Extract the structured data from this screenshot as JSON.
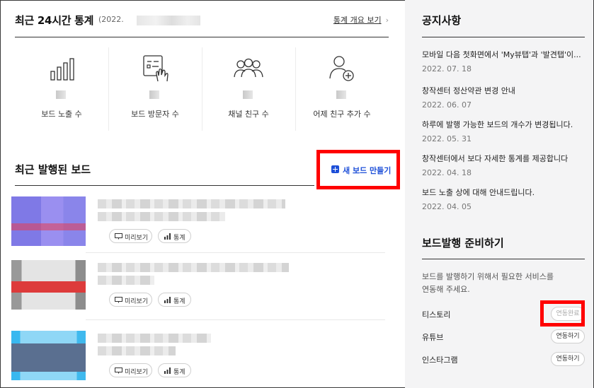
{
  "stats": {
    "title": "최근 24시간 통계",
    "date_prefix": "(2022.",
    "overview_link": "통계 개요 보기",
    "items": [
      {
        "label": "보드 노출 수",
        "icon": "bar-chart-icon"
      },
      {
        "label": "보드 방문자 수",
        "icon": "board-touch-icon"
      },
      {
        "label": "채널 친구 수",
        "icon": "group-friends-icon"
      },
      {
        "label": "어제 친구 추가 수",
        "icon": "add-friend-icon"
      }
    ]
  },
  "boards": {
    "title": "최근 발행된 보드",
    "new_board_label": "새 보드 만들기",
    "preview_label": "미리보기",
    "stats_label": "통계"
  },
  "notices": {
    "title": "공지사항",
    "items": [
      {
        "title": "모바일 다음 첫화면에서 'My뷰탭'과 '발견탭'이...",
        "date": "2022. 07. 18"
      },
      {
        "title": "창작센터 정산약관 변경 안내",
        "date": "2022. 06. 07"
      },
      {
        "title": "하루에 발행 가능한 보드의 개수가 변경됩니다.",
        "date": "2022. 05. 31"
      },
      {
        "title": "창작센터에서 보다 자세한 통계를 제공합니다",
        "date": "2022. 04. 18"
      },
      {
        "title": "보드 노출 상에 대해 안내드립니다.",
        "date": "2022. 04. 05"
      }
    ]
  },
  "prep": {
    "title": "보드발행 준비하기",
    "desc_line1": "보드를 발행하기 위해서 필요한 서비스를",
    "desc_line2": "연동해 주세요.",
    "services": [
      {
        "name": "티스토리",
        "button": "연동완료"
      },
      {
        "name": "유튜브",
        "button": "연동하기"
      },
      {
        "name": "인스타그램",
        "button": "연동하기"
      }
    ]
  },
  "colors": {
    "accent": "#1d4fd8",
    "highlight": "#ff0000",
    "side_bg": "#f4f4f5"
  }
}
